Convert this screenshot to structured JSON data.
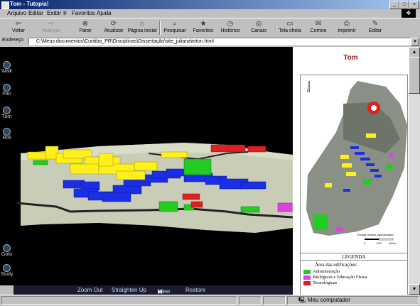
{
  "window": {
    "title": "Tom - Tutopia!"
  },
  "menu": [
    "Arquivo",
    "Editar",
    "Exibir",
    "Ir",
    "Favoritos",
    "Ajuda"
  ],
  "toolbar": [
    {
      "label": "Voltar",
      "icon": "back-arrow-icon",
      "glyph": "⇦",
      "disabled": false
    },
    {
      "label": "Avançar",
      "icon": "forward-arrow-icon",
      "glyph": "⇨",
      "disabled": true
    },
    {
      "label": "Parar",
      "icon": "stop-icon",
      "glyph": "⊗",
      "disabled": false
    },
    {
      "label": "Atualizar",
      "icon": "refresh-icon",
      "glyph": "⟳",
      "disabled": false
    },
    {
      "label": "Página inicial",
      "icon": "home-icon",
      "glyph": "⌂",
      "disabled": false
    },
    {
      "label": "Pesquisar",
      "icon": "search-icon",
      "glyph": "⌕",
      "disabled": false
    },
    {
      "label": "Favoritos",
      "icon": "favorites-icon",
      "glyph": "★",
      "disabled": false
    },
    {
      "label": "Histórico",
      "icon": "history-icon",
      "glyph": "◷",
      "disabled": false
    },
    {
      "label": "Canais",
      "icon": "channels-icon",
      "glyph": "◎",
      "disabled": false
    },
    {
      "label": "Tela cheia",
      "icon": "fullscreen-icon",
      "glyph": "▭",
      "disabled": false
    },
    {
      "label": "Correio",
      "icon": "mail-icon",
      "glyph": "✉",
      "disabled": false
    },
    {
      "label": "Imprimir",
      "icon": "print-icon",
      "glyph": "⎙",
      "disabled": false
    },
    {
      "label": "Editar",
      "icon": "edit-icon",
      "glyph": "✎",
      "disabled": false
    }
  ],
  "address": {
    "label": "Endereço",
    "value": "C:\\Meus documentos\\Curitiba_PR\\Disciplinas\\Dissertação\\site_juliana\\mton.html"
  },
  "vrml_nav": {
    "top": [
      "Walk",
      "Pan",
      "Turn",
      "Roll"
    ],
    "bottom": [
      "Goto",
      "Study"
    ]
  },
  "vrml_controls": {
    "zoom_out": "Zoom Out",
    "straighten_up": "Straighten Up",
    "view": "View",
    "restore": "Restore"
  },
  "map": {
    "title": "Tom",
    "north": "N",
    "scale_caption": "Escala Gráfica (aproximada)",
    "scale_ticks": [
      "0",
      "200",
      "400m"
    ]
  },
  "legend": {
    "title": "LEGENDA",
    "subtitle": "Área das edificações:",
    "items": [
      {
        "label": "Administração",
        "color": "#22cc22"
      },
      {
        "label": "Biológicas e Educação Física",
        "color": "#e040e0"
      },
      {
        "label": "Tecnológicas",
        "color": "#e02020"
      }
    ]
  },
  "status": {
    "zone": "Meu computador"
  },
  "colors": {
    "administracao": "#22cc22",
    "biologicas": "#e040e0",
    "tecnologicas": "#e02020",
    "humanas": "#1a2ee6",
    "outros": "#ffef1a"
  }
}
